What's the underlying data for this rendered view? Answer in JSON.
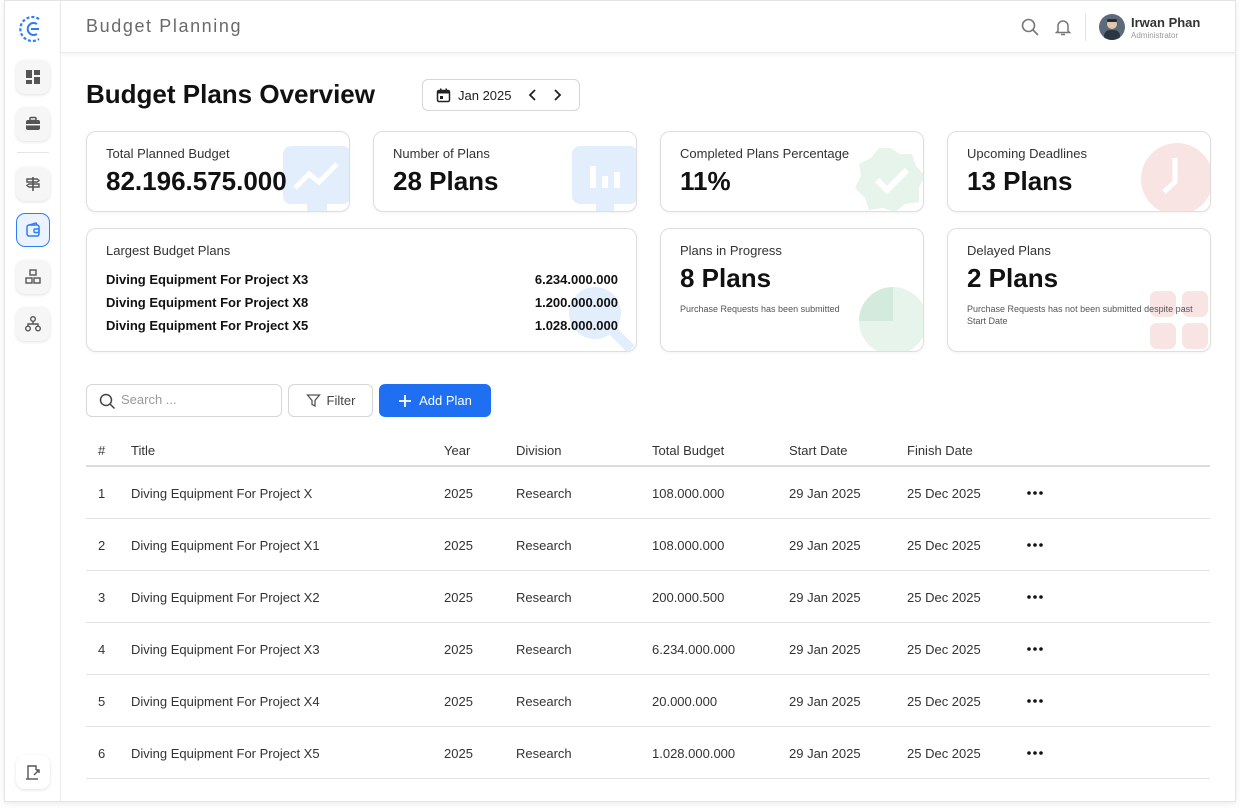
{
  "header": {
    "app_title": "Budget Planning",
    "user_name": "Irwan Phan",
    "user_role": "Administrator"
  },
  "page": {
    "title": "Budget Plans Overview",
    "period": "Jan 2025"
  },
  "cards": {
    "total_budget": {
      "label": "Total Planned Budget",
      "value": "82.196.575.000"
    },
    "num_plans": {
      "label": "Number of Plans",
      "value": "28 Plans"
    },
    "completed": {
      "label": "Completed Plans Percentage",
      "value": "11%"
    },
    "deadlines": {
      "label": "Upcoming Deadlines",
      "value": "13 Plans"
    },
    "largest": {
      "label": "Largest Budget Plans",
      "items": [
        {
          "name": "Diving Equipment For Project X3",
          "value": "6.234.000.000"
        },
        {
          "name": "Diving Equipment For Project X8",
          "value": "1.200.000.000"
        },
        {
          "name": "Diving Equipment For Project X5",
          "value": "1.028.000.000"
        }
      ]
    },
    "in_progress": {
      "label": "Plans in Progress",
      "value": "8 Plans",
      "note": "Purchase Requests has been submitted"
    },
    "delayed": {
      "label": "Delayed Plans",
      "value": "2 Plans",
      "note": "Purchase Requests has not been submitted despite past Start Date"
    }
  },
  "toolbar": {
    "search_placeholder": "Search ...",
    "filter_label": "Filter",
    "add_label": "Add Plan"
  },
  "table": {
    "columns": {
      "num": "#",
      "title": "Title",
      "year": "Year",
      "division": "Division",
      "budget": "Total Budget",
      "start": "Start Date",
      "finish": "Finish Date"
    },
    "rows": [
      {
        "num": "1",
        "title": "Diving Equipment For Project X",
        "year": "2025",
        "division": "Research",
        "budget": "108.000.000",
        "start": "29 Jan 2025",
        "finish": "25 Dec 2025"
      },
      {
        "num": "2",
        "title": "Diving Equipment For Project X1",
        "year": "2025",
        "division": "Research",
        "budget": "108.000.000",
        "start": "29 Jan 2025",
        "finish": "25 Dec 2025"
      },
      {
        "num": "3",
        "title": "Diving Equipment For Project X2",
        "year": "2025",
        "division": "Research",
        "budget": "200.000.500",
        "start": "29 Jan 2025",
        "finish": "25 Dec 2025"
      },
      {
        "num": "4",
        "title": "Diving Equipment For Project X3",
        "year": "2025",
        "division": "Research",
        "budget": "6.234.000.000",
        "start": "29 Jan 2025",
        "finish": "25 Dec 2025"
      },
      {
        "num": "5",
        "title": "Diving Equipment For Project X4",
        "year": "2025",
        "division": "Research",
        "budget": "20.000.000",
        "start": "29 Jan 2025",
        "finish": "25 Dec 2025"
      },
      {
        "num": "6",
        "title": "Diving Equipment For Project X5",
        "year": "2025",
        "division": "Research",
        "budget": "1.028.000.000",
        "start": "29 Jan 2025",
        "finish": "25 Dec 2025"
      }
    ]
  },
  "icons": {
    "logo": "logo-icon",
    "sidebar": [
      "dashboard-icon",
      "briefcase-icon",
      "signpost-icon",
      "wallet-icon",
      "boxes-icon",
      "network-icon",
      "logout-icon"
    ],
    "header": [
      "search-icon",
      "bell-icon"
    ]
  },
  "colors": {
    "accent": "#1e6ff2",
    "blue_deco": "#e3eefc",
    "green_deco": "#e6f4ec",
    "red_deco": "#f9e4e4"
  }
}
